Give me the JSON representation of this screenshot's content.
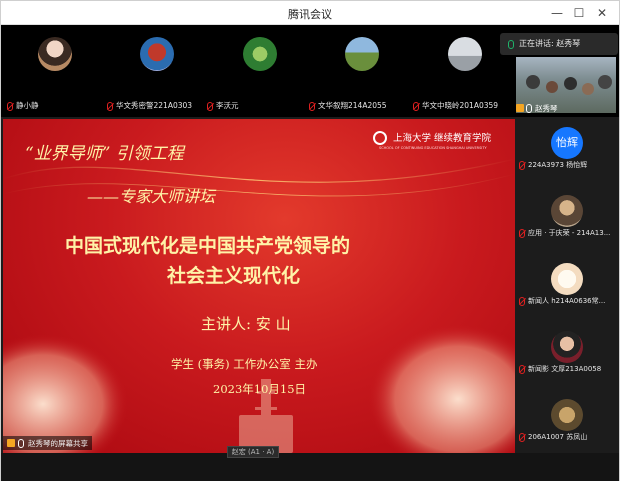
{
  "window": {
    "title": "腾讯会议",
    "minimize_glyph": "—",
    "maximize_glyph": "☐",
    "close_glyph": "✕"
  },
  "speaking": {
    "text": "正在讲话: 赵秀琴"
  },
  "participants_top": [
    {
      "name": "静小静",
      "muted": true
    },
    {
      "name": "华文秀密警221A0303",
      "muted": true
    },
    {
      "name": "李沃元",
      "muted": true
    },
    {
      "name": "文华叙翔214A2055",
      "muted": true
    },
    {
      "name": "华文中晓岭201A0359",
      "muted": true
    }
  ],
  "self_video": {
    "name": "赵秀琴",
    "muted": false
  },
  "participants_side": [
    {
      "name": "224A3973 杨怡辉",
      "avatar_text": "怡辉",
      "muted": true
    },
    {
      "name": "应用 · 于庆荣 - 214A13...",
      "muted": true
    },
    {
      "name": "新闻人 h214A0636常...",
      "muted": true
    },
    {
      "name": "新闻影 文厚213A0058",
      "muted": true
    },
    {
      "name": "206A1007 苏凤山",
      "muted": true
    }
  ],
  "slide": {
    "project_title": "“业界导师” 引领工程",
    "subtitle": "——专家大师讲坛",
    "main_title_line1": "中国式现代化是中国共产党领导的",
    "main_title_line2": "社会主义现代化",
    "speaker": "主讲人: 安  山",
    "organizer": "学生 (事务) 工作办公室  主办",
    "date": "2023年10月15日",
    "institution": "上海大学 继续教育学院",
    "institution_en": "SCHOOL OF CONTINUING EDUCATION SHANGHAI UNIVERSITY"
  },
  "share_status": {
    "text": "赵秀琴的屏幕共享"
  },
  "watermark": {
    "text": "赵宏 (A1 · A)"
  },
  "colors": {
    "slide_red": "#c8141a",
    "slide_gold": "#fff3a8",
    "muted_red": "#e02020",
    "accent_blue": "#1677ff"
  }
}
